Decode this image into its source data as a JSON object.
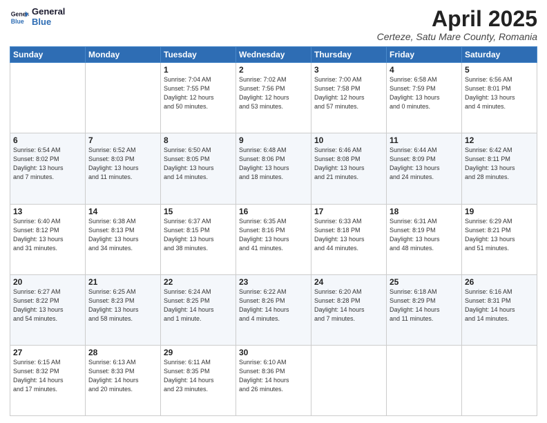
{
  "logo": {
    "line1": "General",
    "line2": "Blue"
  },
  "title": "April 2025",
  "subtitle": "Certeze, Satu Mare County, Romania",
  "weekdays": [
    "Sunday",
    "Monday",
    "Tuesday",
    "Wednesday",
    "Thursday",
    "Friday",
    "Saturday"
  ],
  "weeks": [
    [
      {
        "day": "",
        "info": ""
      },
      {
        "day": "",
        "info": ""
      },
      {
        "day": "1",
        "info": "Sunrise: 7:04 AM\nSunset: 7:55 PM\nDaylight: 12 hours\nand 50 minutes."
      },
      {
        "day": "2",
        "info": "Sunrise: 7:02 AM\nSunset: 7:56 PM\nDaylight: 12 hours\nand 53 minutes."
      },
      {
        "day": "3",
        "info": "Sunrise: 7:00 AM\nSunset: 7:58 PM\nDaylight: 12 hours\nand 57 minutes."
      },
      {
        "day": "4",
        "info": "Sunrise: 6:58 AM\nSunset: 7:59 PM\nDaylight: 13 hours\nand 0 minutes."
      },
      {
        "day": "5",
        "info": "Sunrise: 6:56 AM\nSunset: 8:01 PM\nDaylight: 13 hours\nand 4 minutes."
      }
    ],
    [
      {
        "day": "6",
        "info": "Sunrise: 6:54 AM\nSunset: 8:02 PM\nDaylight: 13 hours\nand 7 minutes."
      },
      {
        "day": "7",
        "info": "Sunrise: 6:52 AM\nSunset: 8:03 PM\nDaylight: 13 hours\nand 11 minutes."
      },
      {
        "day": "8",
        "info": "Sunrise: 6:50 AM\nSunset: 8:05 PM\nDaylight: 13 hours\nand 14 minutes."
      },
      {
        "day": "9",
        "info": "Sunrise: 6:48 AM\nSunset: 8:06 PM\nDaylight: 13 hours\nand 18 minutes."
      },
      {
        "day": "10",
        "info": "Sunrise: 6:46 AM\nSunset: 8:08 PM\nDaylight: 13 hours\nand 21 minutes."
      },
      {
        "day": "11",
        "info": "Sunrise: 6:44 AM\nSunset: 8:09 PM\nDaylight: 13 hours\nand 24 minutes."
      },
      {
        "day": "12",
        "info": "Sunrise: 6:42 AM\nSunset: 8:11 PM\nDaylight: 13 hours\nand 28 minutes."
      }
    ],
    [
      {
        "day": "13",
        "info": "Sunrise: 6:40 AM\nSunset: 8:12 PM\nDaylight: 13 hours\nand 31 minutes."
      },
      {
        "day": "14",
        "info": "Sunrise: 6:38 AM\nSunset: 8:13 PM\nDaylight: 13 hours\nand 34 minutes."
      },
      {
        "day": "15",
        "info": "Sunrise: 6:37 AM\nSunset: 8:15 PM\nDaylight: 13 hours\nand 38 minutes."
      },
      {
        "day": "16",
        "info": "Sunrise: 6:35 AM\nSunset: 8:16 PM\nDaylight: 13 hours\nand 41 minutes."
      },
      {
        "day": "17",
        "info": "Sunrise: 6:33 AM\nSunset: 8:18 PM\nDaylight: 13 hours\nand 44 minutes."
      },
      {
        "day": "18",
        "info": "Sunrise: 6:31 AM\nSunset: 8:19 PM\nDaylight: 13 hours\nand 48 minutes."
      },
      {
        "day": "19",
        "info": "Sunrise: 6:29 AM\nSunset: 8:21 PM\nDaylight: 13 hours\nand 51 minutes."
      }
    ],
    [
      {
        "day": "20",
        "info": "Sunrise: 6:27 AM\nSunset: 8:22 PM\nDaylight: 13 hours\nand 54 minutes."
      },
      {
        "day": "21",
        "info": "Sunrise: 6:25 AM\nSunset: 8:23 PM\nDaylight: 13 hours\nand 58 minutes."
      },
      {
        "day": "22",
        "info": "Sunrise: 6:24 AM\nSunset: 8:25 PM\nDaylight: 14 hours\nand 1 minute."
      },
      {
        "day": "23",
        "info": "Sunrise: 6:22 AM\nSunset: 8:26 PM\nDaylight: 14 hours\nand 4 minutes."
      },
      {
        "day": "24",
        "info": "Sunrise: 6:20 AM\nSunset: 8:28 PM\nDaylight: 14 hours\nand 7 minutes."
      },
      {
        "day": "25",
        "info": "Sunrise: 6:18 AM\nSunset: 8:29 PM\nDaylight: 14 hours\nand 11 minutes."
      },
      {
        "day": "26",
        "info": "Sunrise: 6:16 AM\nSunset: 8:31 PM\nDaylight: 14 hours\nand 14 minutes."
      }
    ],
    [
      {
        "day": "27",
        "info": "Sunrise: 6:15 AM\nSunset: 8:32 PM\nDaylight: 14 hours\nand 17 minutes."
      },
      {
        "day": "28",
        "info": "Sunrise: 6:13 AM\nSunset: 8:33 PM\nDaylight: 14 hours\nand 20 minutes."
      },
      {
        "day": "29",
        "info": "Sunrise: 6:11 AM\nSunset: 8:35 PM\nDaylight: 14 hours\nand 23 minutes."
      },
      {
        "day": "30",
        "info": "Sunrise: 6:10 AM\nSunset: 8:36 PM\nDaylight: 14 hours\nand 26 minutes."
      },
      {
        "day": "",
        "info": ""
      },
      {
        "day": "",
        "info": ""
      },
      {
        "day": "",
        "info": ""
      }
    ]
  ]
}
